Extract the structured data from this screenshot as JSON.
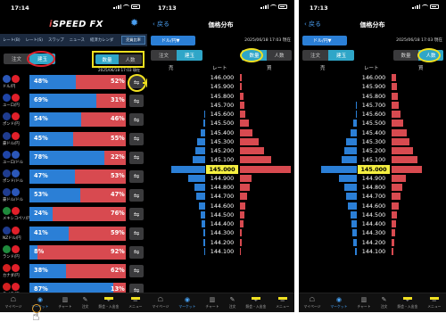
{
  "status": {
    "time": "17:14",
    "time2": "17:13",
    "time3": "17:13"
  },
  "p1": {
    "logo_i": "i",
    "logo_rest": "SPEED FX",
    "nav": [
      "レート(B)",
      "レート(S)",
      "スワップ",
      "ニュース",
      "経済カレンダ"
    ],
    "nav_gold": "売買比率",
    "seg1": [
      "注文",
      "建玉"
    ],
    "seg2": [
      "数量",
      "人数"
    ],
    "date": "2025/06/18 17:03 現在",
    "rows": [
      {
        "pair": "ドル/円",
        "left": "48%",
        "right": "52%",
        "lv": 48,
        "c1": "#2b57b8",
        "c2": "#e0202a"
      },
      {
        "pair": "ユーロ/円",
        "left": "69%",
        "right": "31%",
        "lv": 69,
        "c1": "#1f45a8",
        "c2": "#e0202a"
      },
      {
        "pair": "ポンド/円",
        "left": "54%",
        "right": "46%",
        "lv": 54,
        "c1": "#1f3c90",
        "c2": "#e0202a"
      },
      {
        "pair": "豪ドル/円",
        "left": "45%",
        "right": "55%",
        "lv": 45,
        "c1": "#1f3c90",
        "c2": "#e0202a"
      },
      {
        "pair": "ユーロ/ドル",
        "left": "78%",
        "right": "22%",
        "lv": 78,
        "c1": "#1f45a8",
        "c2": "#2b57b8"
      },
      {
        "pair": "ポンド/ドル",
        "left": "47%",
        "right": "53%",
        "lv": 47,
        "c1": "#1f3c90",
        "c2": "#2b57b8"
      },
      {
        "pair": "豪ドル/ドル",
        "left": "53%",
        "right": "47%",
        "lv": 53,
        "c1": "#1f3c90",
        "c2": "#2b57b8"
      },
      {
        "pair": "メキシコペソ/円",
        "left": "24%",
        "right": "76%",
        "lv": 24,
        "c1": "#1f8a3c",
        "c2": "#e0202a"
      },
      {
        "pair": "NZドル/円",
        "left": "41%",
        "right": "59%",
        "lv": 41,
        "c1": "#1f3c90",
        "c2": "#e0202a"
      },
      {
        "pair": "ランド/円",
        "left": "8%",
        "right": "92%",
        "lv": 8,
        "c1": "#1f8a3c",
        "c2": "#e0202a"
      },
      {
        "pair": "カナダ/円",
        "left": "38%",
        "right": "62%",
        "lv": 38,
        "c1": "#d42020",
        "c2": "#e0202a"
      },
      {
        "pair": "スイス/円",
        "left": "87%",
        "right": "13%",
        "lv": 87,
        "c1": "#d42020",
        "c2": "#e0202a"
      }
    ]
  },
  "tabs": [
    "マイページ",
    "マーケット",
    "チャート",
    "注文",
    "照会・入出金",
    "メニュー"
  ],
  "dist": {
    "back": "戻る",
    "title": "価格分布",
    "pair": "ドル/円▼",
    "date": "2025/06/18 17:03 現在",
    "seg_a": [
      "注文",
      "建玉"
    ],
    "seg_b": [
      "数量",
      "人数"
    ],
    "sell": "売",
    "rate": "レート",
    "buy": "買",
    "current": "145.000",
    "rates": [
      "146.000",
      "145.900",
      "145.800",
      "145.700",
      "145.600",
      "145.500",
      "145.400",
      "145.300",
      "145.200",
      "145.100",
      "145.000",
      "144.900",
      "144.800",
      "144.700",
      "144.600",
      "144.500",
      "144.400",
      "144.300",
      "144.200",
      "144.100"
    ],
    "p2_sell": [
      0,
      0,
      0,
      0,
      1,
      4,
      8,
      15,
      18,
      24,
      63,
      31,
      20,
      16,
      12,
      8,
      6,
      4,
      3,
      2
    ],
    "p2_buy": [
      4,
      4,
      6,
      8,
      10,
      16,
      24,
      35,
      45,
      58,
      95,
      22,
      18,
      14,
      10,
      8,
      6,
      4,
      3,
      2
    ],
    "p3_sell": [
      0,
      0,
      0,
      1,
      2,
      6,
      12,
      20,
      24,
      28,
      66,
      33,
      24,
      20,
      16,
      12,
      10,
      8,
      6,
      4
    ],
    "p3_buy": [
      8,
      10,
      12,
      14,
      16,
      22,
      28,
      34,
      40,
      48,
      56,
      26,
      20,
      16,
      14,
      10,
      8,
      6,
      5,
      4
    ]
  }
}
